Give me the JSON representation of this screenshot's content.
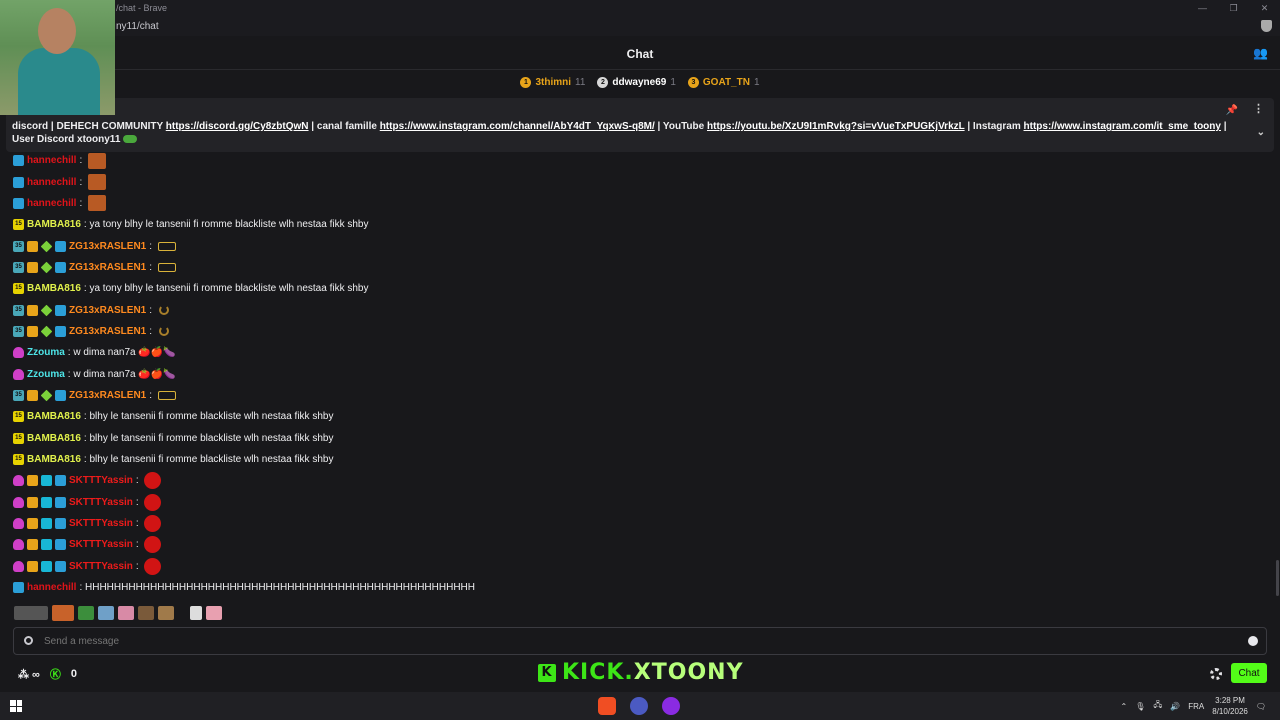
{
  "browser": {
    "title": "/chat - Brave",
    "url": "ny11/chat"
  },
  "header": {
    "title": "Chat"
  },
  "leaderboard": [
    {
      "rank": "1",
      "name": "3thimni",
      "count": "11",
      "color": "#e8a41a"
    },
    {
      "rank": "2",
      "name": "ddwayne69",
      "count": "1",
      "color": "#ffffff"
    },
    {
      "rank": "3",
      "name": "GOAT_TN",
      "count": "1",
      "color": "#e8a41a"
    }
  ],
  "pinned": {
    "text_1": "discord | DEHECH COMMUNITY ",
    "link_1": "https://discord.gg/Cy8zbtQwN",
    "text_2": " | canal famille ",
    "link_2": "https://www.instagram.com/channel/AbY4dT_YqxwS-q8M/",
    "text_3": " | YouTube ",
    "link_3": "https://youtu.be/XzU9I1mRvkg?si=vVueTxPUGKjVrkzL",
    "text_4": " | Instagram ",
    "link_4": "https://www.instagram.com/it_sme_toony",
    "text_5": " | User Discord xtoony11"
  },
  "messages": [
    {
      "badges": [
        "mod"
      ],
      "user": "hannechill",
      "color": "#e0141a",
      "text": "",
      "emote": "brown"
    },
    {
      "badges": [
        "mod"
      ],
      "user": "hannechill",
      "color": "#e0141a",
      "text": "",
      "emote": "brown"
    },
    {
      "badges": [
        "mod"
      ],
      "user": "hannechill",
      "color": "#e0141a",
      "text": "",
      "emote": "brown"
    },
    {
      "badges": [
        "15"
      ],
      "user": "BAMBA816",
      "color": "#e2f24c",
      "text": "ya tony blhy le tansenii fi romme blackliste wlh nestaa fikk shby",
      "emote": ""
    },
    {
      "badges": [
        "35",
        "crown",
        "diamond",
        "mod"
      ],
      "user": "ZG13xRASLEN1",
      "color": "#ff8a1f",
      "text": "",
      "emote": "small"
    },
    {
      "badges": [
        "35",
        "crown",
        "diamond",
        "mod"
      ],
      "user": "ZG13xRASLEN1",
      "color": "#ff8a1f",
      "text": "",
      "emote": "small"
    },
    {
      "badges": [
        "15"
      ],
      "user": "BAMBA816",
      "color": "#e2f24c",
      "text": "ya tony blhy le tansenii fi romme blackliste wlh nestaa fikk shby",
      "emote": ""
    },
    {
      "badges": [
        "35",
        "crown",
        "diamond",
        "mod"
      ],
      "user": "ZG13xRASLEN1",
      "color": "#ff8a1f",
      "text": "",
      "emote": "spin"
    },
    {
      "badges": [
        "35",
        "crown",
        "diamond",
        "mod"
      ],
      "user": "ZG13xRASLEN1",
      "color": "#ff8a1f",
      "text": "",
      "emote": "spin"
    },
    {
      "badges": [
        "pink"
      ],
      "user": "Zzouma",
      "color": "#4ee5e8",
      "text": "w dima nan7a 🍅🍎🍆",
      "emote": ""
    },
    {
      "badges": [
        "pink"
      ],
      "user": "Zzouma",
      "color": "#4ee5e8",
      "text": "w dima nan7a 🍅🍎🍆",
      "emote": ""
    },
    {
      "badges": [
        "35",
        "crown",
        "diamond",
        "mod"
      ],
      "user": "ZG13xRASLEN1",
      "color": "#ff8a1f",
      "text": "",
      "emote": "small"
    },
    {
      "badges": [
        "15"
      ],
      "user": "BAMBA816",
      "color": "#e2f24c",
      "text": "blhy le tansenii fi romme blackliste wlh nestaa fikk shby",
      "emote": ""
    },
    {
      "badges": [
        "15"
      ],
      "user": "BAMBA816",
      "color": "#e2f24c",
      "text": "blhy le tansenii fi romme blackliste wlh nestaa fikk shby",
      "emote": ""
    },
    {
      "badges": [
        "15"
      ],
      "user": "BAMBA816",
      "color": "#e2f24c",
      "text": "blhy le tansenii fi romme blackliste wlh nestaa fikk shby",
      "emote": ""
    },
    {
      "badges": [
        "pink",
        "crown",
        "cyan",
        "mod"
      ],
      "user": "SKTTTYassin",
      "color": "#ee1b1b",
      "text": "",
      "emote": "red"
    },
    {
      "badges": [
        "pink",
        "crown",
        "cyan",
        "mod"
      ],
      "user": "SKTTTYassin",
      "color": "#ee1b1b",
      "text": "",
      "emote": "red"
    },
    {
      "badges": [
        "pink",
        "crown",
        "cyan",
        "mod"
      ],
      "user": "SKTTTYassin",
      "color": "#ee1b1b",
      "text": "",
      "emote": "red"
    },
    {
      "badges": [
        "pink",
        "crown",
        "cyan",
        "mod"
      ],
      "user": "SKTTTYassin",
      "color": "#ee1b1b",
      "text": "",
      "emote": "red"
    },
    {
      "badges": [
        "pink",
        "crown",
        "cyan",
        "mod"
      ],
      "user": "SKTTTYassin",
      "color": "#ee1b1b",
      "text": "",
      "emote": "red"
    },
    {
      "badges": [
        "mod"
      ],
      "user": "hannechill",
      "color": "#e0141a",
      "text": "HHHHHHHHHHHHHHHHHHHHHHHHHHHHHHHHHHHHHHHHHHHHHHHHHHHHHH",
      "emote": ""
    }
  ],
  "input": {
    "placeholder": "Send a message"
  },
  "footer": {
    "viewer_count": "0",
    "brand_kick": "KICK.",
    "brand_name": "XTOONY",
    "chat_button": "Chat"
  },
  "taskbar": {
    "lang": "FRA",
    "time": "3:28 PM",
    "date": "8/10/2026"
  }
}
